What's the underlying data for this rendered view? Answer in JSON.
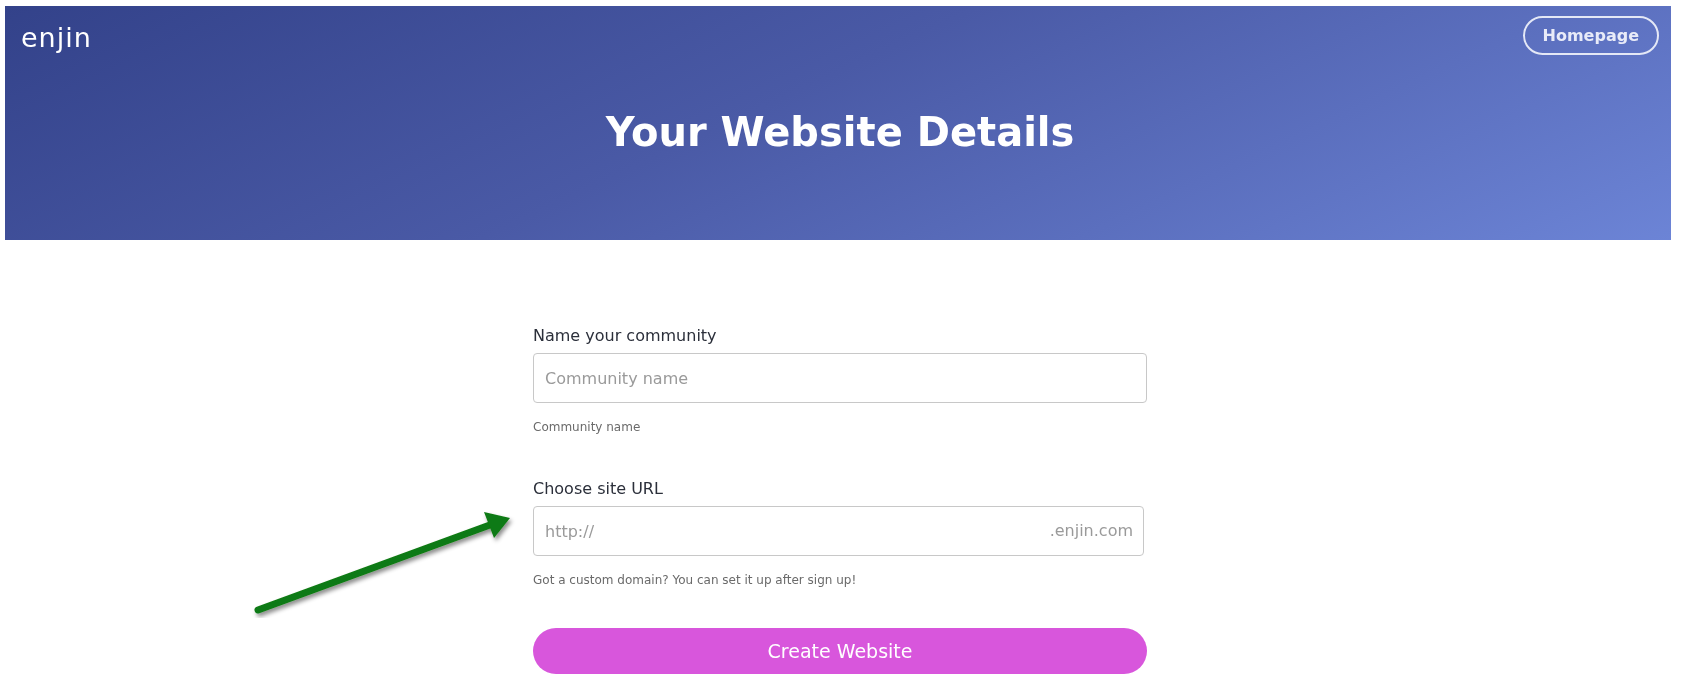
{
  "header": {
    "logo": "enjin",
    "homepage_button": "Homepage",
    "title": "Your Website Details"
  },
  "form": {
    "fields": [
      {
        "kind": "text",
        "label": "Name your community",
        "placeholder": "Community name",
        "help": "Community name"
      },
      {
        "kind": "url",
        "label": "Choose site URL",
        "placeholder": "http://",
        "suffix": ".enjin.com",
        "help": "Got a custom domain? You can set it up after sign up!"
      }
    ],
    "submit": "Create Website"
  }
}
